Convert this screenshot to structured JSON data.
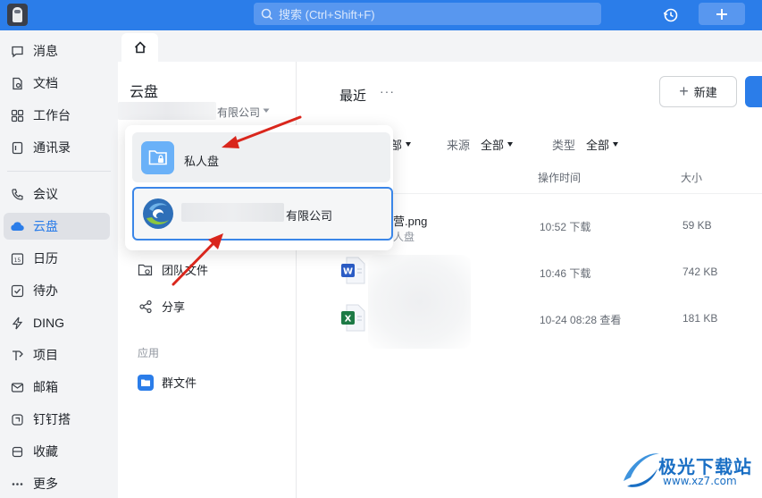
{
  "topbar": {
    "search_placeholder": "搜索 (Ctrl+Shift+F)",
    "accent": "#2b7de9"
  },
  "nav": {
    "items": [
      {
        "label": "消息",
        "icon": "message-icon"
      },
      {
        "label": "文档",
        "icon": "document-icon"
      },
      {
        "label": "工作台",
        "icon": "workbench-icon"
      },
      {
        "label": "通讯录",
        "icon": "contacts-icon"
      },
      {
        "label": "会议",
        "icon": "phone-icon"
      },
      {
        "label": "云盘",
        "icon": "cloud-icon",
        "active": true
      },
      {
        "label": "日历",
        "icon": "calendar-icon"
      },
      {
        "label": "待办",
        "icon": "todo-icon"
      },
      {
        "label": "DING",
        "icon": "lightning-icon"
      },
      {
        "label": "项目",
        "icon": "project-icon"
      },
      {
        "label": "邮箱",
        "icon": "mail-icon"
      },
      {
        "label": "钉钉搭",
        "icon": "builder-icon"
      },
      {
        "label": "收藏",
        "icon": "favorite-icon"
      },
      {
        "label": "更多",
        "icon": "more-icon"
      }
    ]
  },
  "cloud": {
    "title": "云盘",
    "org_suffix": "有限公司",
    "side_items": {
      "team_files": "团队文件",
      "share": "分享"
    },
    "apps_label": "应用",
    "group_files": "群文件"
  },
  "popup": {
    "private_drive": "私人盘",
    "org_suffix": "有限公司"
  },
  "main": {
    "title": "最近",
    "more": "···",
    "new_button": "新建",
    "filters": {
      "owner_value": "部",
      "owner_all": "全部",
      "source_label": "来源",
      "source_value": "全部",
      "type_label": "类型",
      "type_value": "全部"
    },
    "columns": {
      "time": "操作时间",
      "size": "大小"
    },
    "files": [
      {
        "name": "营.png",
        "sub": "人盘",
        "time": "10:52 下载",
        "size": "59 KB",
        "icon": "image-file-icon"
      },
      {
        "name": "",
        "sub": "",
        "time": "10:46 下载",
        "size": "742 KB",
        "icon": "word-file-icon"
      },
      {
        "name": "",
        "sub": "",
        "time": "10-24 08:28 查看",
        "size": "181 KB",
        "icon": "excel-file-icon"
      }
    ]
  },
  "watermark": {
    "text": "极光下载站",
    "url": "www.xz7.com"
  }
}
